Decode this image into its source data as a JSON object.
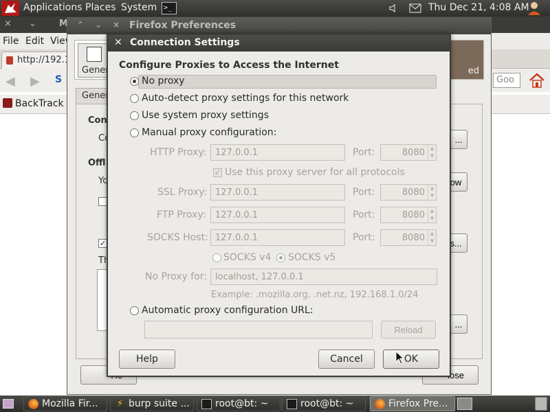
{
  "top_panel": {
    "menus": [
      "Applications",
      "Places",
      "System"
    ],
    "clock": "Thu Dec 21,  4:08 AM"
  },
  "firefox": {
    "title_fragment": "M",
    "menubar": [
      "File",
      "Edit",
      "View"
    ],
    "tab_label": "http://192.1",
    "search_placeholder": "Goo",
    "bookmark": "BackTrack L"
  },
  "prefs": {
    "title": "Firefox Preferences",
    "pane_general": "General",
    "pane_advanced": "ed",
    "tab_general": "Gener",
    "frag_conn": "Con",
    "frag_co": "Co",
    "frag_offl": "Offl",
    "frag_yo": "Yo",
    "frag_th": "Th",
    "btn_settings": "...",
    "btn_now": "ow",
    "btn_exceptions": "s...",
    "btn_remove": "...",
    "btn_help": "He",
    "btn_close": "lose"
  },
  "dialog": {
    "title": "Connection Settings",
    "heading": "Configure Proxies to Access the Internet",
    "options": {
      "no_proxy": "No proxy",
      "auto_detect": "Auto-detect proxy settings for this network",
      "system": "Use system proxy settings",
      "manual": "Manual proxy configuration:",
      "auto_url": "Automatic proxy configuration URL:"
    },
    "selected_option": "no_proxy",
    "manual": {
      "http_label": "HTTP Proxy:",
      "http_value": "127.0.0.1",
      "http_port": "8080",
      "use_for_all": "Use this proxy server for all protocols",
      "use_for_all_checked": true,
      "ssl_label": "SSL Proxy:",
      "ssl_value": "127.0.0.1",
      "ssl_port": "8080",
      "ftp_label": "FTP Proxy:",
      "ftp_value": "127.0.0.1",
      "ftp_port": "8080",
      "socks_label": "SOCKS Host:",
      "socks_value": "127.0.0.1",
      "socks_port": "8080",
      "port_label": "Port:",
      "socks_v4": "SOCKS v4",
      "socks_v5": "SOCKS v5",
      "socks_version_selected": "v5",
      "no_proxy_label": "No Proxy for:",
      "no_proxy_value": "localhost, 127.0.0.1",
      "example": "Example: .mozilla.org, .net.nz, 192.168.1.0/24"
    },
    "auto_url_value": "",
    "reload": "Reload",
    "help": "Help",
    "cancel": "Cancel",
    "ok": "OK"
  },
  "taskbar": {
    "tasks": [
      "Mozilla Fir...",
      "burp suite ...",
      "root@bt: ~",
      "root@bt: ~",
      "Firefox Pre..."
    ]
  },
  "colors": {
    "panel": "#3b3b38",
    "dialog_bg": "#edebe8",
    "disabled_text": "#a6a39e",
    "advanced_pane": "#7b6a59"
  }
}
